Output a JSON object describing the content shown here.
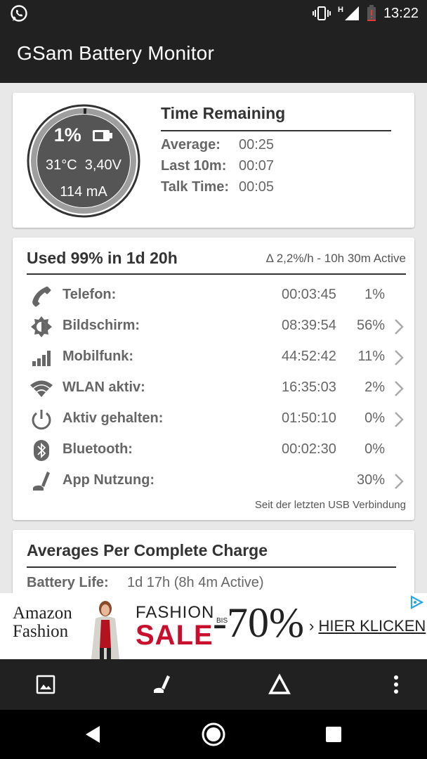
{
  "status_bar": {
    "time": "13:22",
    "network_type": "H",
    "icons": [
      "whatsapp-icon",
      "vibrate-icon",
      "signal-icon",
      "battery-low-icon"
    ]
  },
  "app_bar": {
    "title": "GSam Battery Monitor"
  },
  "battery": {
    "percent": "1%",
    "temp_voltage": "31°C  3,40V",
    "current": "114 mA",
    "level_fraction": 0.01
  },
  "time_remaining": {
    "title": "Time Remaining",
    "rows": [
      {
        "label": "Average:",
        "value": "00:25"
      },
      {
        "label": "Last 10m:",
        "value": "00:07"
      },
      {
        "label": "Talk Time:",
        "value": "00:05"
      }
    ]
  },
  "usage": {
    "title": "Used 99% in 1d 20h",
    "subtitle": "Δ 2,2%/h - 10h 30m Active",
    "rows": [
      {
        "icon": "phone-icon",
        "name": "Telefon:",
        "time": "00:03:45",
        "percent": "1%",
        "has_chevron": false
      },
      {
        "icon": "brightness-icon",
        "name": "Bildschirm:",
        "time": "08:39:54",
        "percent": "56%",
        "has_chevron": true
      },
      {
        "icon": "cell-signal-icon",
        "name": "Mobilfunk:",
        "time": "44:52:42",
        "percent": "11%",
        "has_chevron": true
      },
      {
        "icon": "wifi-icon",
        "name": "WLAN aktiv:",
        "time": "16:35:03",
        "percent": "2%",
        "has_chevron": true
      },
      {
        "icon": "power-icon",
        "name": "Aktiv gehalten:",
        "time": "01:50:10",
        "percent": "0%",
        "has_chevron": true
      },
      {
        "icon": "bluetooth-icon",
        "name": "Bluetooth:",
        "time": "00:02:30",
        "percent": "0%",
        "has_chevron": false
      },
      {
        "icon": "app-usage-icon",
        "name": "App Nutzung:",
        "time": "",
        "percent": "30%",
        "has_chevron": true
      }
    ],
    "note": "Seit der letzten USB Verbindung"
  },
  "averages": {
    "title": "Averages Per Complete Charge",
    "rows": [
      {
        "label": "Battery Life:",
        "value": "1d 17h (8h 4m Active)"
      }
    ]
  },
  "ad": {
    "brand_line1": "Amazon",
    "brand_line2": "Fashion",
    "fashion": "FASHION",
    "sale": "SALE",
    "bis": "BIS",
    "discount": "-70%",
    "cta_arrow": "›",
    "cta": "HIER KLICKEN"
  },
  "toolbar": {
    "icons": [
      "image-icon",
      "app-usage-icon",
      "delta-icon",
      "overflow-menu-icon"
    ]
  },
  "navbar": {
    "icons": [
      "back-icon",
      "home-icon",
      "recents-icon"
    ]
  },
  "colors": {
    "bar_bg": "#212121",
    "card_bg": "#ffffff",
    "page_bg": "#e8e8e8",
    "text_dark": "#333333",
    "text_gray": "#666666",
    "sale_red": "#c8102e",
    "gauge_fill": "#555555"
  }
}
